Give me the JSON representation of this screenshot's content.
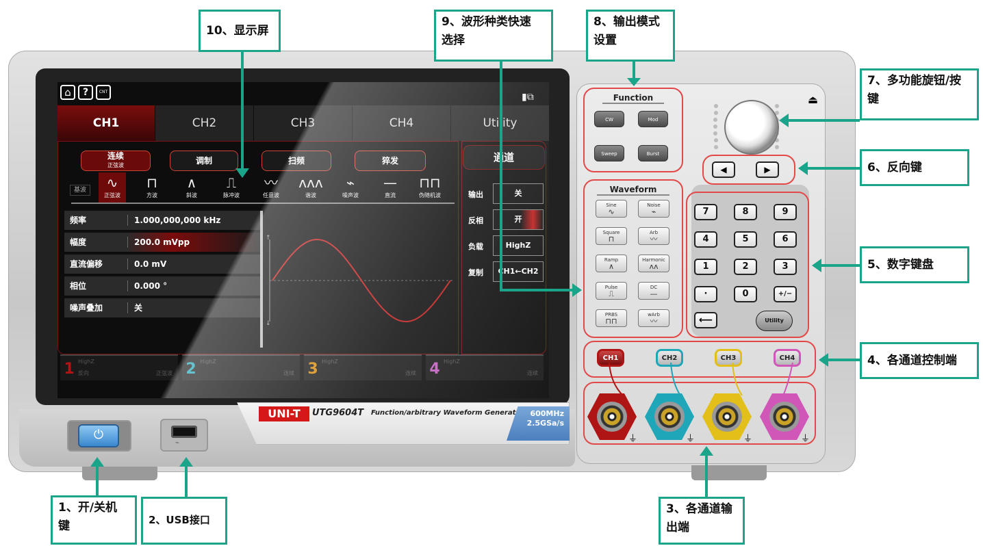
{
  "callouts": {
    "c10": "10、显示屏",
    "c9": "9、波形种类快速\n选择",
    "c8": "8、输出模式\n设置",
    "c7": "7、多功能旋钮/按\n键",
    "c6": "6、反向键",
    "c5": "5、数字键盘",
    "c4": "4、各通道控制端",
    "c3": "3、各通道输\n出端",
    "c2": "2、USB接口",
    "c1": "1、开/关机\n键"
  },
  "screen": {
    "top_icons": [
      "⌂",
      "?",
      "CNT"
    ],
    "tabs": [
      "CH1",
      "CH2",
      "CH3",
      "CH4",
      "Utility"
    ],
    "modes": [
      {
        "label": "连续",
        "sub": "正弦波"
      },
      {
        "label": "调制",
        "sub": ""
      },
      {
        "label": "扫频",
        "sub": ""
      },
      {
        "label": "猝发",
        "sub": ""
      }
    ],
    "channel_header": "通道",
    "base_label": "基波",
    "waves": [
      {
        "glyph": "∿",
        "label": "正弦波"
      },
      {
        "glyph": "⊓",
        "label": "方波"
      },
      {
        "glyph": "∧",
        "label": "斜波"
      },
      {
        "glyph": "⎍",
        "label": "脉冲波"
      },
      {
        "glyph": "〰",
        "label": "任意波"
      },
      {
        "glyph": "ʌʌʌ",
        "label": "谐波"
      },
      {
        "glyph": "⌁",
        "label": "噪声波"
      },
      {
        "glyph": "—",
        "label": "直流"
      },
      {
        "glyph": "⊓⊓",
        "label": "伪随机波"
      }
    ],
    "params": [
      {
        "key": "频率",
        "value": "1.000,000,000 kHz"
      },
      {
        "key": "幅度",
        "value": "200.0 mVpp"
      },
      {
        "key": "直流偏移",
        "value": "0.0 mV"
      },
      {
        "key": "相位",
        "value": "0.000 °"
      },
      {
        "key": "噪声叠加",
        "value": "关"
      }
    ],
    "channel_settings": [
      {
        "key": "输出",
        "value": "关"
      },
      {
        "key": "反相",
        "value": "开"
      },
      {
        "key": "负载",
        "value": "HighZ"
      },
      {
        "key": "复制",
        "value": "CH1←CH2"
      }
    ],
    "strips": [
      {
        "num": "1",
        "load": "HighZ",
        "sub": "反向",
        "wave": "正弦波",
        "color": "#b01515"
      },
      {
        "num": "2",
        "load": "HighZ",
        "sub": "",
        "wave": "连续",
        "color": "#1fa6b8"
      },
      {
        "num": "3",
        "load": "HighZ",
        "sub": "",
        "wave": "连续",
        "color": "#d68a0c"
      },
      {
        "num": "4",
        "load": "HighZ",
        "sub": "",
        "wave": "连续",
        "color": "#c05fbf"
      }
    ]
  },
  "brand": {
    "logo": "UNI-T",
    "model": "UTG9604T",
    "desc": "Function/arbitrary Waveform Generator",
    "spec1": "600MHz",
    "spec2": "2.5GSa/s"
  },
  "panel": {
    "function_label": "Function",
    "function_keys": [
      "CW",
      "Mod",
      "Sweep",
      "Burst"
    ],
    "waveform_label": "Waveform",
    "waveform_keys": [
      {
        "label": "Sine",
        "glyph": "∿"
      },
      {
        "label": "Noise",
        "glyph": "⌁"
      },
      {
        "label": "Square",
        "glyph": "⊓"
      },
      {
        "label": "Arb",
        "glyph": "〰"
      },
      {
        "label": "Ramp",
        "glyph": "∧"
      },
      {
        "label": "Harmonic",
        "glyph": "ʌʌ"
      },
      {
        "label": "Pulse",
        "glyph": "⎍"
      },
      {
        "label": "DC",
        "glyph": "—"
      },
      {
        "label": "PRBS",
        "glyph": "⊓⊓"
      },
      {
        "label": "wArb",
        "glyph": "〰"
      }
    ],
    "numpad": [
      "7",
      "8",
      "9",
      "4",
      "5",
      "6",
      "1",
      "2",
      "3",
      "·",
      "0",
      "+/−"
    ],
    "backspace": "⟵",
    "utility": "Utility",
    "arrows": [
      "◀",
      "▶"
    ],
    "channel_keys": [
      "CH1",
      "CH2",
      "CH3",
      "CH4"
    ],
    "channel_colors": [
      "#b01515",
      "#1fa6b8",
      "#e3bf1a",
      "#d056b8"
    ],
    "ground_symbol": "⏚"
  },
  "front": {
    "power_symbol": "⏻",
    "usb_symbol": "⌁"
  }
}
